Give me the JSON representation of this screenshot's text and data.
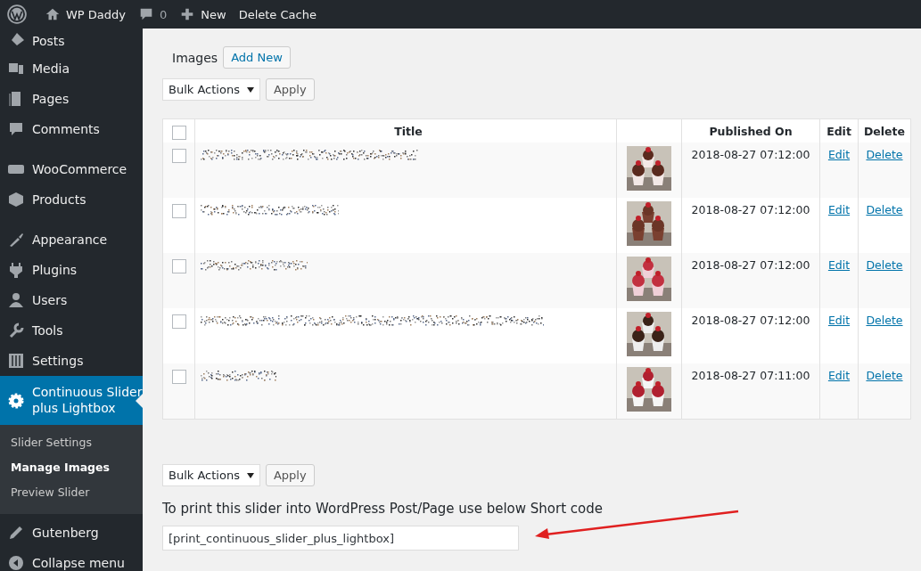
{
  "admin_bar": {
    "site": "WP Daddy",
    "comments": "0",
    "new": "New",
    "cache": "Delete Cache"
  },
  "sidebar": {
    "groups": [
      {
        "items": [
          {
            "label": "Posts",
            "selected": false
          },
          {
            "label": "Media",
            "selected": false
          },
          {
            "label": "Pages",
            "selected": false
          },
          {
            "label": "Comments",
            "selected": false
          }
        ]
      },
      {
        "items": [
          {
            "label": "WooCommerce",
            "selected": false
          },
          {
            "label": "Products",
            "selected": false
          }
        ]
      },
      {
        "items": [
          {
            "label": "Appearance",
            "selected": false
          },
          {
            "label": "Plugins",
            "selected": false
          },
          {
            "label": "Users",
            "selected": false
          },
          {
            "label": "Tools",
            "selected": false
          },
          {
            "label": "Settings",
            "selected": false
          },
          {
            "label": "Continuous Slider plus Lightbox",
            "selected": true,
            "children": [
              {
                "label": "Slider Settings",
                "selected": false
              },
              {
                "label": "Manage Images",
                "selected": true
              },
              {
                "label": "Preview Slider",
                "selected": false
              }
            ]
          },
          {
            "label": "Gutenberg",
            "selected": false
          },
          {
            "label": "Collapse menu",
            "selected": false
          }
        ]
      }
    ]
  },
  "page": {
    "title": "Images",
    "add_new": "Add New"
  },
  "bulk_top": {
    "select": "Bulk Actions",
    "apply": "Apply"
  },
  "table": {
    "columns": [
      "Title",
      "Published On",
      "Edit",
      "Delete"
    ],
    "header_checked": false,
    "rows": [
      {
        "checked": false,
        "published": "2018-08-27 07:12:00",
        "edit": "Edit",
        "delete": "Delete"
      },
      {
        "checked": false,
        "published": "2018-08-27 07:12:00",
        "edit": "Edit",
        "delete": "Delete"
      },
      {
        "checked": false,
        "published": "2018-08-27 07:12:00",
        "edit": "Edit",
        "delete": "Delete"
      },
      {
        "checked": false,
        "published": "2018-08-27 07:12:00",
        "edit": "Edit",
        "delete": "Delete"
      },
      {
        "checked": false,
        "published": "2018-08-27 07:11:00",
        "edit": "Edit",
        "delete": "Delete"
      }
    ]
  },
  "bulk_bottom": {
    "select": "Bulk Actions",
    "apply": "Apply"
  },
  "shortcode": {
    "label": "To print this slider into WordPress Post/Page use below Short code",
    "value": "[print_continuous_slider_plus_lightbox]"
  }
}
